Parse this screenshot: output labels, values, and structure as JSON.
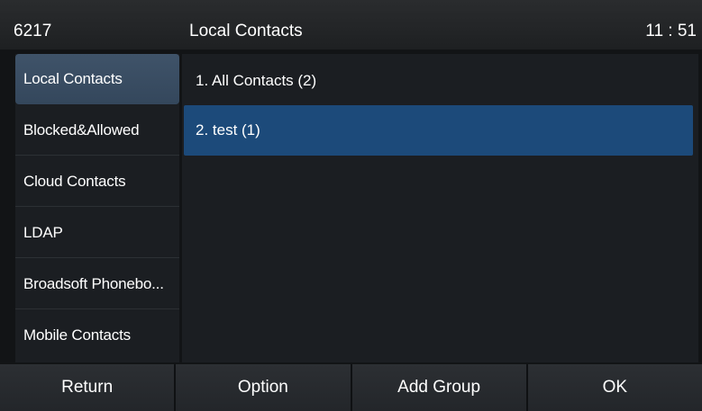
{
  "header": {
    "account": "6217",
    "title": "Local Contacts",
    "time": "11 : 51"
  },
  "sidebar": {
    "items": [
      {
        "label": "Local Contacts",
        "selected": true
      },
      {
        "label": "Blocked&Allowed",
        "selected": false
      },
      {
        "label": "Cloud Contacts",
        "selected": false
      },
      {
        "label": "LDAP",
        "selected": false
      },
      {
        "label": "Broadsoft Phonebo...",
        "selected": false
      },
      {
        "label": "Mobile Contacts",
        "selected": false
      }
    ]
  },
  "content": {
    "rows": [
      {
        "label": "1.  All Contacts (2)",
        "selected": false
      },
      {
        "label": "2.  test (1)",
        "selected": true
      }
    ]
  },
  "softkeys": {
    "return_label": "Return",
    "option_label": "Option",
    "add_group_label": "Add Group",
    "ok_label": "OK"
  },
  "colors": {
    "selected_row": "#1c4a7a",
    "selected_sidebar": "#3f5369",
    "panel_bg": "#1b1e22"
  }
}
